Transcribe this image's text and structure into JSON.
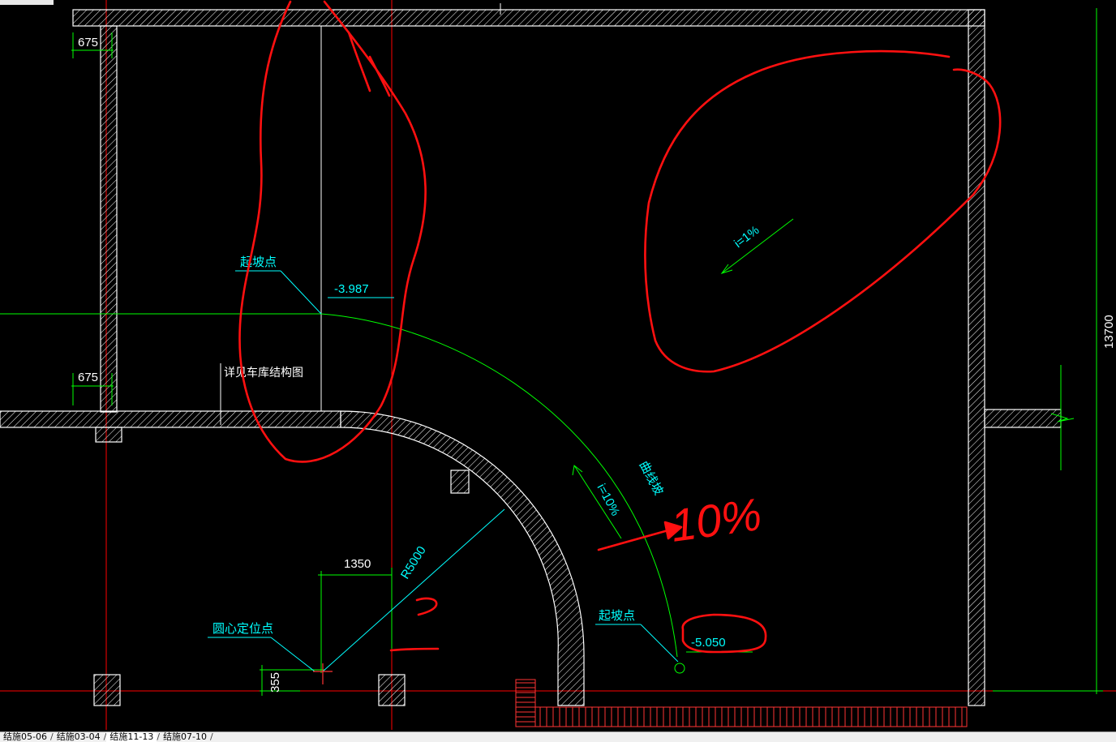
{
  "drawing": {
    "colors": {
      "wall": "#ffffff",
      "hatch": "#ffffff",
      "dimension": "#00ff00",
      "annotation_text": "#00ffff",
      "axis_line": "#ff0000",
      "markup": "#ff1010",
      "label_text": "#ffffff"
    },
    "dimensions": {
      "top_left_width": "675",
      "mid_left_width": "675",
      "center_offset": "1350",
      "center_height": "355",
      "total_height": "13700"
    },
    "annotations": {
      "slope_start_top_label": "起坡点",
      "slope_start_top_elevation": "-3.987",
      "slope_start_bottom_label": "起坡点",
      "slope_start_bottom_elevation": "-5.050",
      "circle_center_label": "圆心定位点",
      "radius_label": "R5000",
      "slope_gradient": "i=1%",
      "ramp_slope": "i=10%",
      "ramp_name": "曲线坡",
      "side_note": "详见车库结构图"
    },
    "handwritten_markup": {
      "note_text": "10%",
      "mark_two": "二"
    }
  },
  "tabs": [
    {
      "label": "结施05-06",
      "active": false
    },
    {
      "label": "结施03-04",
      "active": false
    },
    {
      "label": "结施11-13",
      "active": true
    },
    {
      "label": "结施07-10",
      "active": false
    }
  ]
}
